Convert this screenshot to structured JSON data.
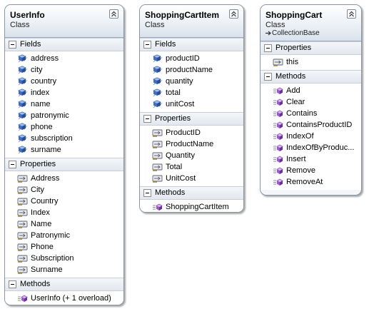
{
  "classes": [
    {
      "name": "UserInfo",
      "kind": "Class",
      "base": "",
      "fields_label": "Fields",
      "fields": [
        "address",
        "city",
        "country",
        "index",
        "name",
        "patronymic",
        "phone",
        "subscription",
        "surname"
      ],
      "properties_label": "Properties",
      "properties": [
        "Address",
        "City",
        "Country",
        "Index",
        "Name",
        "Patronymic",
        "Phone",
        "Subscription",
        "Surname"
      ],
      "methods_label": "Methods",
      "methods": [
        "UserInfo (+ 1 overload)"
      ]
    },
    {
      "name": "ShoppingCartItem",
      "kind": "Class",
      "base": "",
      "fields_label": "Fields",
      "fields": [
        "productID",
        "productName",
        "quantity",
        "total",
        "unitCost"
      ],
      "properties_label": "Properties",
      "properties": [
        "ProductID",
        "ProductName",
        "Quantity",
        "Total",
        "UnitCost"
      ],
      "methods_label": "Methods",
      "methods": [
        "ShoppingCartItem"
      ]
    },
    {
      "name": "ShoppingCart",
      "kind": "Class",
      "base": "CollectionBase",
      "fields_label": "",
      "fields": [],
      "properties_label": "Properties",
      "properties": [
        "this"
      ],
      "methods_label": "Methods",
      "methods": [
        "Add",
        "Clear",
        "Contains",
        "ContainsProductID",
        "IndexOf",
        "IndexOfByProduc...",
        "Insert",
        "Remove",
        "RemoveAt"
      ]
    }
  ],
  "colors": {
    "field_icon": "#3f6fc0",
    "property_icon": "#5b6270",
    "method_icon": "#9b59c6",
    "border": "#8a96a6"
  },
  "icons": {
    "field": "field-icon",
    "property": "property-icon",
    "method": "method-icon",
    "collapse": "collapse-chevron-icon",
    "base_arrow": "inheritance-arrow-icon"
  }
}
